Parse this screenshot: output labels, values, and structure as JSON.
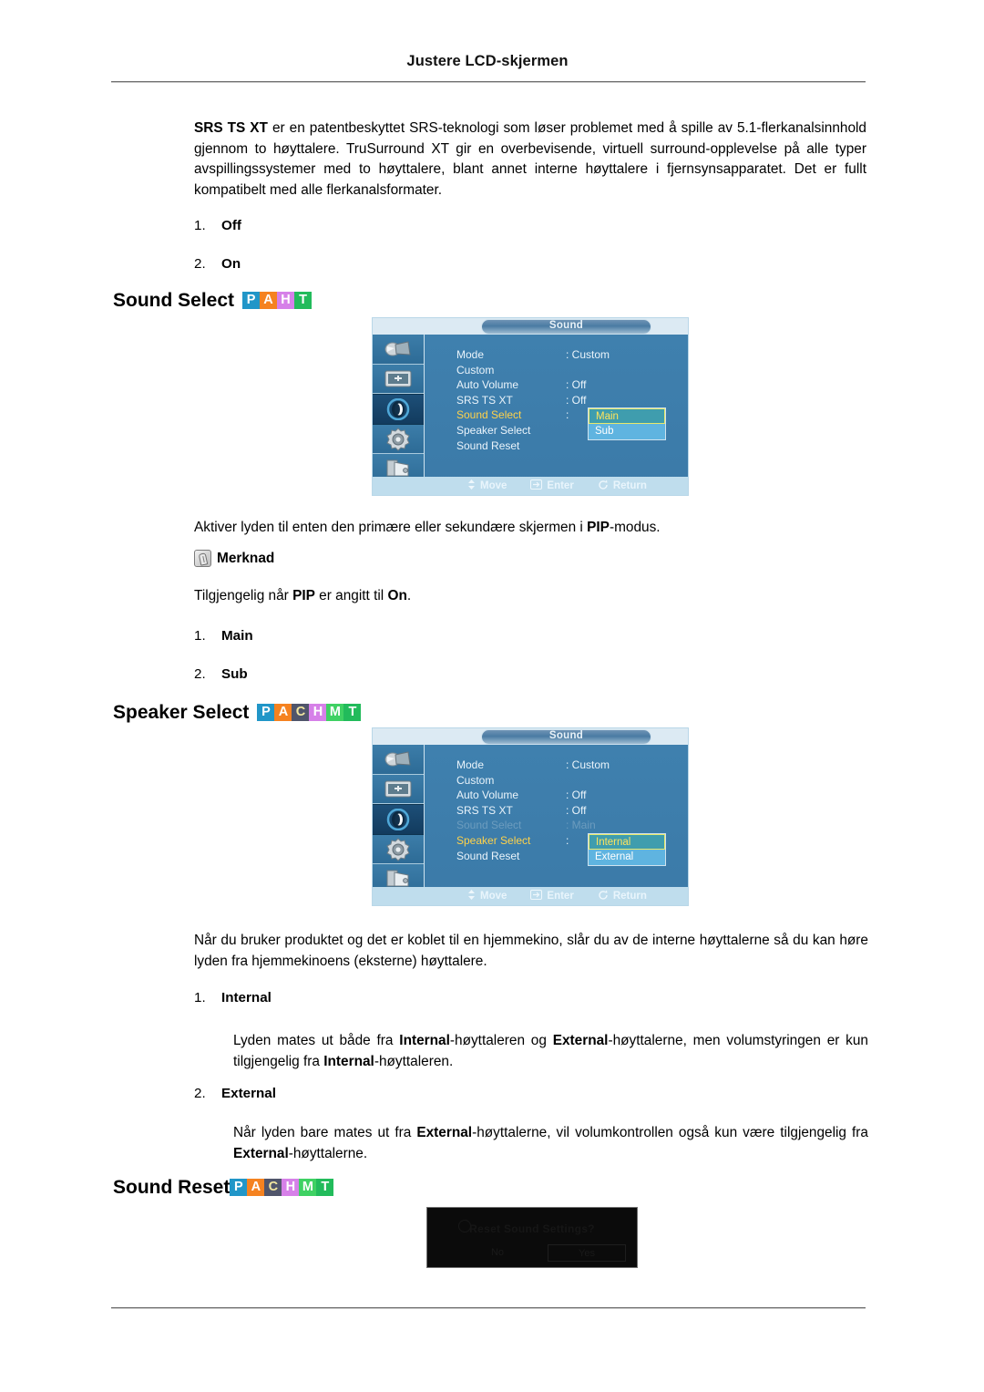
{
  "header": {
    "title": "Justere LCD-skjermen"
  },
  "intro": {
    "html_lead": "SRS TS XT",
    "text": " er en patentbeskyttet SRS-teknologi som løser problemet med å spille av 5.1-flerkanalsinnhold gjennom to høyttalere. TruSurround XT gir en overbevisende, virtuell surround-opplevelse på alle typer avspillingssystemer med to høyttalere, blant annet interne høyttalere i fjernsynsapparatet. Det er fullt kompatibelt med alle flerkanalsformater.",
    "items": [
      {
        "num": "1.",
        "label": "Off"
      },
      {
        "num": "2.",
        "label": "On"
      }
    ]
  },
  "sections": [
    {
      "heading": "Sound Select",
      "badges": [
        {
          "letter": "P",
          "bg": "#2196c8",
          "fg": "#ffffff"
        },
        {
          "letter": "A",
          "bg": "#f58220",
          "fg": "#ffffff"
        },
        {
          "letter": "H",
          "bg": "#d680e8",
          "fg": "#ffffff"
        },
        {
          "letter": "T",
          "bg": "#22bb5b",
          "fg": "#ffffff"
        }
      ],
      "description_prefix": "Aktiver lyden til enten den primære eller sekundære skjermen i ",
      "description_bold": "PIP",
      "description_suffix": "-modus.",
      "note_label": "Merknad",
      "note_prefix": "Tilgjengelig når ",
      "note_bold1": "PIP",
      "note_mid": " er angitt til ",
      "note_bold2": "On",
      "note_suffix": ".",
      "items": [
        {
          "num": "1.",
          "label": "Main"
        },
        {
          "num": "2.",
          "label": "Sub"
        }
      ]
    },
    {
      "heading": "Speaker Select",
      "badges": [
        {
          "letter": "P",
          "bg": "#2196c8",
          "fg": "#ffffff"
        },
        {
          "letter": "A",
          "bg": "#f58220",
          "fg": "#ffffff"
        },
        {
          "letter": "C",
          "bg": "#50556b",
          "fg": "#f2e7a0"
        },
        {
          "letter": "H",
          "bg": "#d680e8",
          "fg": "#ffffff"
        },
        {
          "letter": "M",
          "bg": "#3fd163",
          "fg": "#ffffff"
        },
        {
          "letter": "T",
          "bg": "#22bb5b",
          "fg": "#ffffff"
        }
      ],
      "description": "Når du bruker produktet og det er koblet til en hjemmekino, slår du av de interne høyttalerne så du kan høre lyden fra hjemmekinoens (eksterne) høyttalere.",
      "items": [
        {
          "num": "1.",
          "label": "Internal"
        },
        {
          "num": "2.",
          "label": "External"
        }
      ],
      "internal_detail": {
        "p1": "Lyden mates ut både fra ",
        "b1": "Internal",
        "p2": "-høyttaleren og ",
        "b2": "External",
        "p3": "-høyttalerne, men volumstyringen er kun tilgjengelig fra ",
        "b3": "Internal",
        "p4": "-høyttaleren."
      },
      "external_detail": {
        "p1": "Når lyden bare mates ut fra ",
        "b1": "External",
        "p2": "-høyttalerne, vil volumkontrollen også kun være tilgjengelig fra ",
        "b2": "External",
        "p3": "-høyttalerne."
      }
    },
    {
      "heading": "Sound Reset",
      "badges": [
        {
          "letter": "P",
          "bg": "#2196c8",
          "fg": "#ffffff"
        },
        {
          "letter": "A",
          "bg": "#f58220",
          "fg": "#ffffff"
        },
        {
          "letter": "C",
          "bg": "#50556b",
          "fg": "#f2e7a0"
        },
        {
          "letter": "H",
          "bg": "#d680e8",
          "fg": "#ffffff"
        },
        {
          "letter": "M",
          "bg": "#3fd163",
          "fg": "#ffffff"
        },
        {
          "letter": "T",
          "bg": "#22bb5b",
          "fg": "#ffffff"
        }
      ]
    }
  ],
  "osd1": {
    "title": "Sound",
    "rows": [
      {
        "label": "Mode",
        "value": ": Custom",
        "state": "normal"
      },
      {
        "label": "Custom",
        "value": "",
        "state": "normal"
      },
      {
        "label": "Auto Volume",
        "value": ": Off",
        "state": "normal"
      },
      {
        "label": "SRS TS XT",
        "value": ": Off",
        "state": "normal"
      },
      {
        "label": "Sound Select",
        "value": ":",
        "state": "active"
      },
      {
        "label": "Speaker Select",
        "value": "",
        "state": "normal"
      },
      {
        "label": "Sound Reset",
        "value": "",
        "state": "normal"
      }
    ],
    "dropdown": {
      "options": [
        {
          "label": "Main",
          "selected": true
        },
        {
          "label": "Sub",
          "selected": false
        }
      ]
    },
    "footer": [
      {
        "icon": "updown-arrow-icon",
        "label": "Move"
      },
      {
        "icon": "enter-icon",
        "label": "Enter"
      },
      {
        "icon": "return-icon",
        "label": "Return"
      }
    ],
    "rail_icons": [
      "picture-icon",
      "display-icon",
      "sound-icon",
      "setup-icon",
      "multicontrol-icon"
    ],
    "rail_selected_index": 2
  },
  "osd2": {
    "title": "Sound",
    "rows": [
      {
        "label": "Mode",
        "value": ": Custom",
        "state": "normal"
      },
      {
        "label": "Custom",
        "value": "",
        "state": "normal"
      },
      {
        "label": "Auto Volume",
        "value": ": Off",
        "state": "normal"
      },
      {
        "label": "SRS TS XT",
        "value": ": Off",
        "state": "normal"
      },
      {
        "label": "Sound Select",
        "value": ": Main",
        "state": "dim"
      },
      {
        "label": "Speaker Select",
        "value": ":",
        "state": "active"
      },
      {
        "label": "Sound Reset",
        "value": "",
        "state": "normal"
      }
    ],
    "dropdown": {
      "options": [
        {
          "label": "Internal",
          "selected": true
        },
        {
          "label": "External",
          "selected": false
        }
      ]
    },
    "footer": [
      {
        "icon": "updown-arrow-icon",
        "label": "Move"
      },
      {
        "icon": "enter-icon",
        "label": "Enter"
      },
      {
        "icon": "return-icon",
        "label": "Return"
      }
    ],
    "rail_icons": [
      "picture-icon",
      "display-icon",
      "sound-icon",
      "setup-icon",
      "multicontrol-icon"
    ],
    "rail_selected_index": 2
  },
  "reset_dialog": {
    "title": "Reset Sound Settings?",
    "no_label": "No",
    "yes_label": "Yes"
  }
}
